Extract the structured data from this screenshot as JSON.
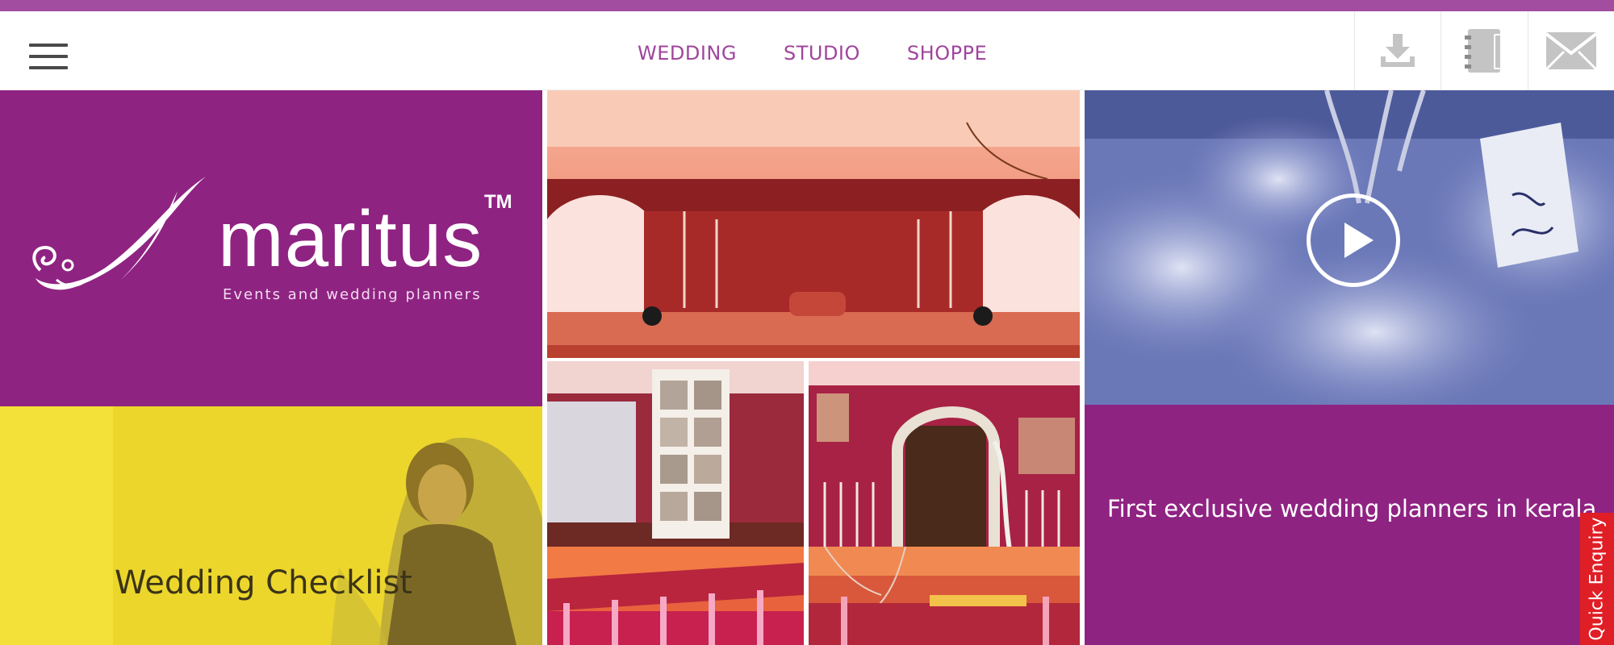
{
  "colors": {
    "brand_purple": "#8f2382",
    "nav_purple": "#a0459d",
    "top_strip": "#a24d9f",
    "enquiry_red": "#e01e26",
    "checklist_yellow": "#ecd62c"
  },
  "nav": {
    "menu_icon": "hamburger-icon",
    "links": [
      "WEDDING",
      "STUDIO",
      "SHOPPE"
    ],
    "icons": [
      "download-icon",
      "notebook-icon",
      "mail-icon"
    ]
  },
  "logo": {
    "wordmark": "maritus",
    "trademark": "TM",
    "tagline": "Events and wedding planners"
  },
  "tiles": {
    "checklist": "Wedding Checklist",
    "tagline": "First exclusive wedding planners in kerala",
    "video_icon": "play-icon"
  },
  "quick_enquiry": "Quick Enquiry"
}
